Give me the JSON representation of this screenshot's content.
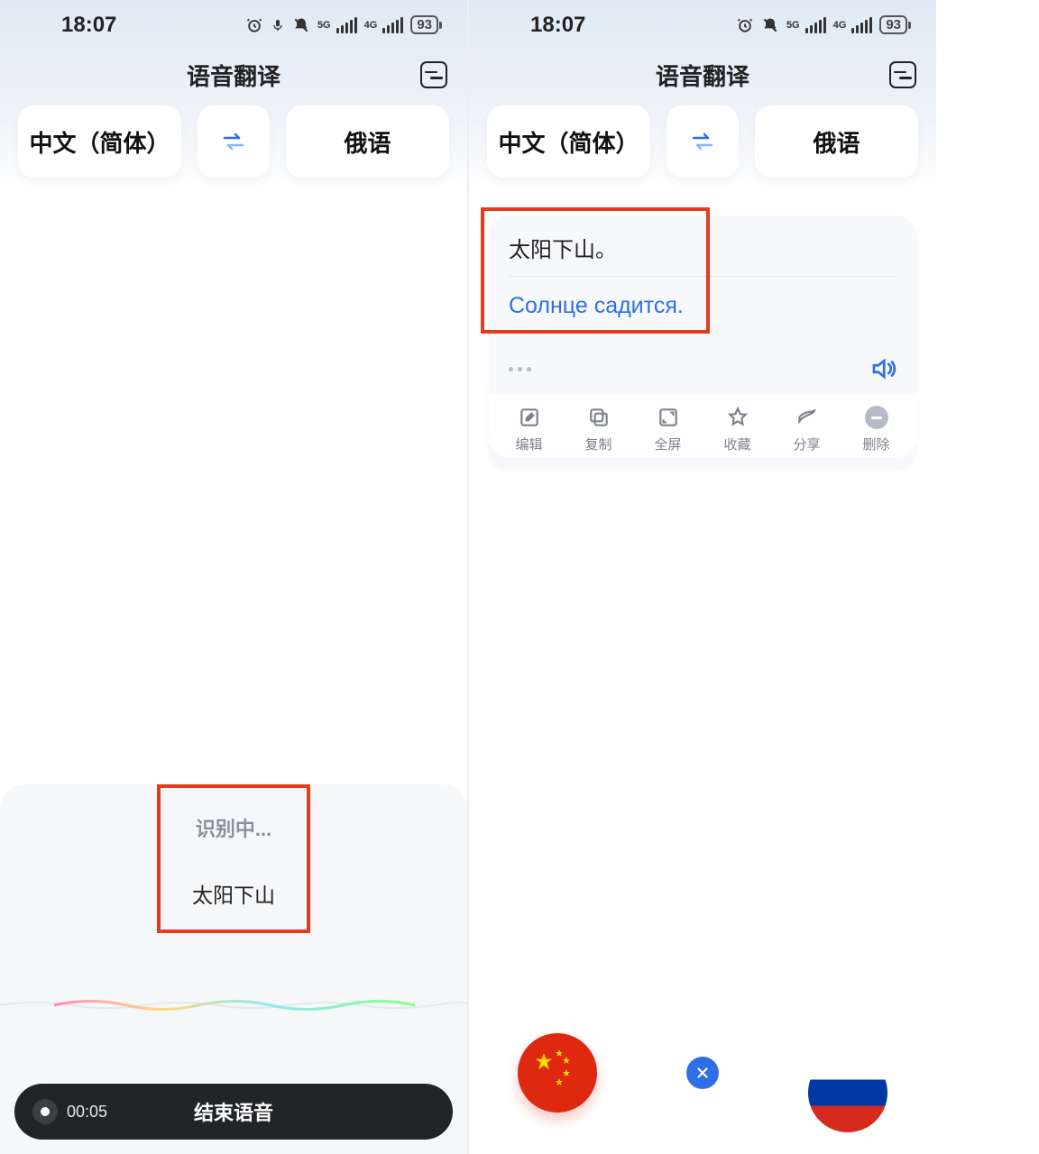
{
  "left": {
    "status": {
      "time": "18:07",
      "battery": "93",
      "net1": "5G",
      "net2": "4G"
    },
    "title": "语音翻译",
    "lang_from": "中文（简体）",
    "lang_to": "俄语",
    "recognizing_label": "识别中...",
    "recognizing_text": "太阳下山",
    "rec_time": "00:05",
    "stop_label": "结束语音"
  },
  "right": {
    "status": {
      "time": "18:07",
      "battery": "93",
      "net1": "5G",
      "net2": "4G"
    },
    "title": "语音翻译",
    "lang_from": "中文（简体）",
    "lang_to": "俄语",
    "card": {
      "source": "太阳下山。",
      "target": "Солнце садится."
    },
    "actions": {
      "edit": "编辑",
      "copy": "复制",
      "fullscreen": "全屏",
      "favorite": "收藏",
      "share": "分享",
      "delete": "删除"
    }
  }
}
